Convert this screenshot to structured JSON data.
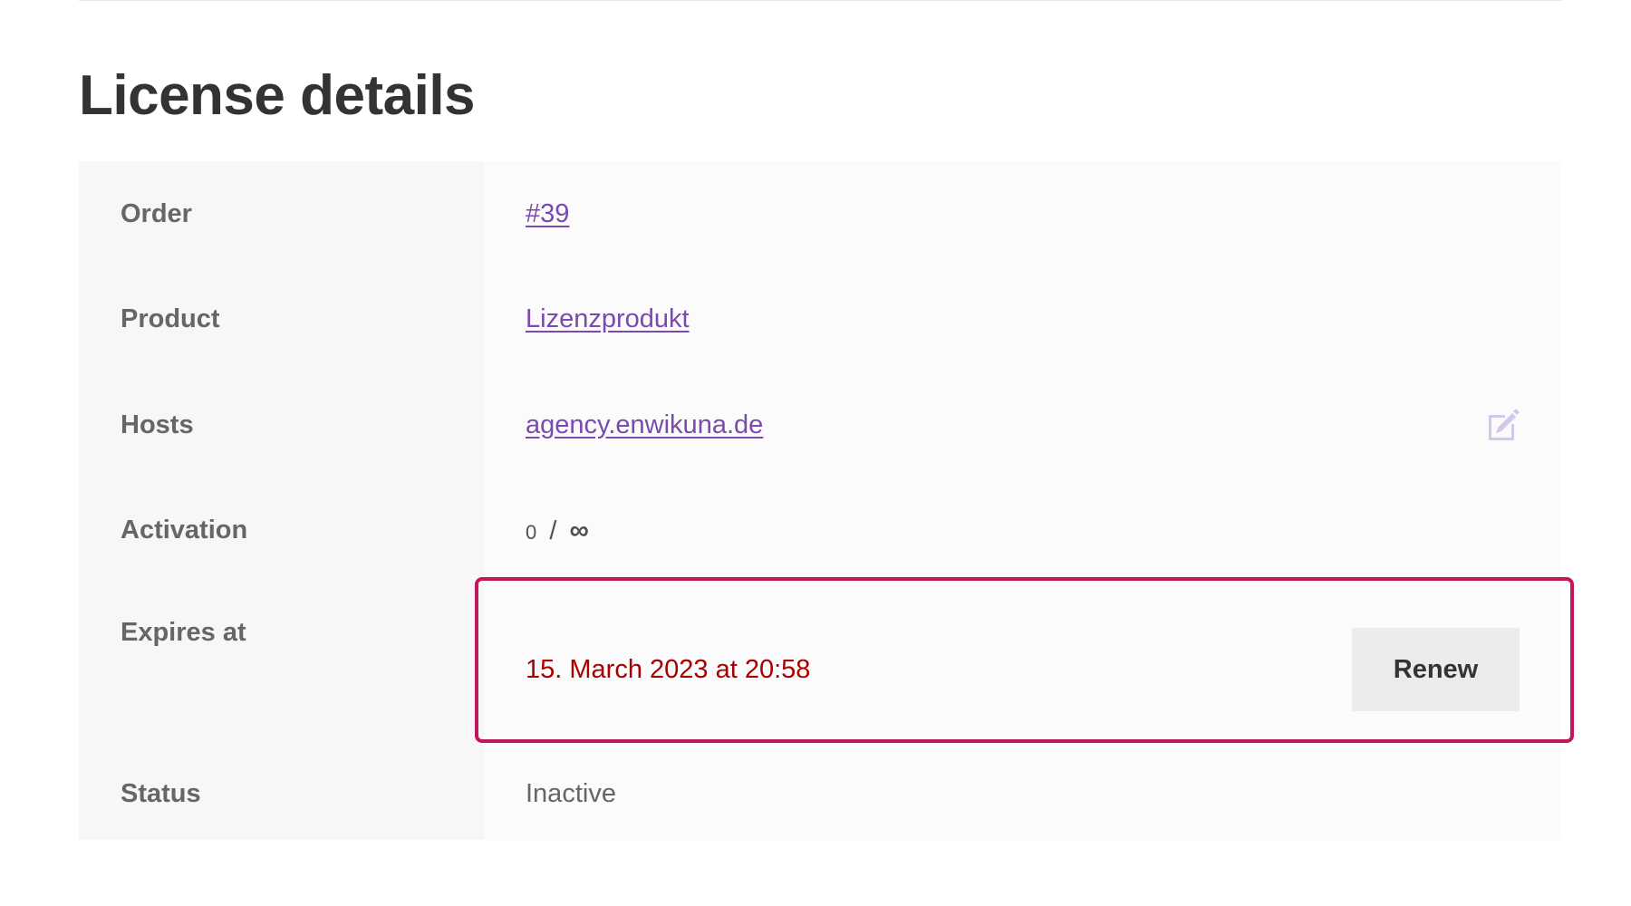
{
  "page": {
    "title": "License details"
  },
  "rows": {
    "order": {
      "label": "Order",
      "value": "#39"
    },
    "product": {
      "label": "Product",
      "value": "Lizenzprodukt"
    },
    "hosts": {
      "label": "Hosts",
      "value": "agency.enwikuna.de",
      "edit_icon": "edit-icon"
    },
    "activation": {
      "label": "Activation",
      "count": "0",
      "separator": "/",
      "max": "∞"
    },
    "expires": {
      "label": "Expires at",
      "value": "15. March 2023 at 20:58",
      "renew_label": "Renew"
    },
    "status": {
      "label": "Status",
      "value": "Inactive"
    }
  },
  "colors": {
    "link": "#7a4aaf",
    "expired": "#a80000",
    "highlight": "#c2185b",
    "edit_icon": "#d4c7ea"
  }
}
